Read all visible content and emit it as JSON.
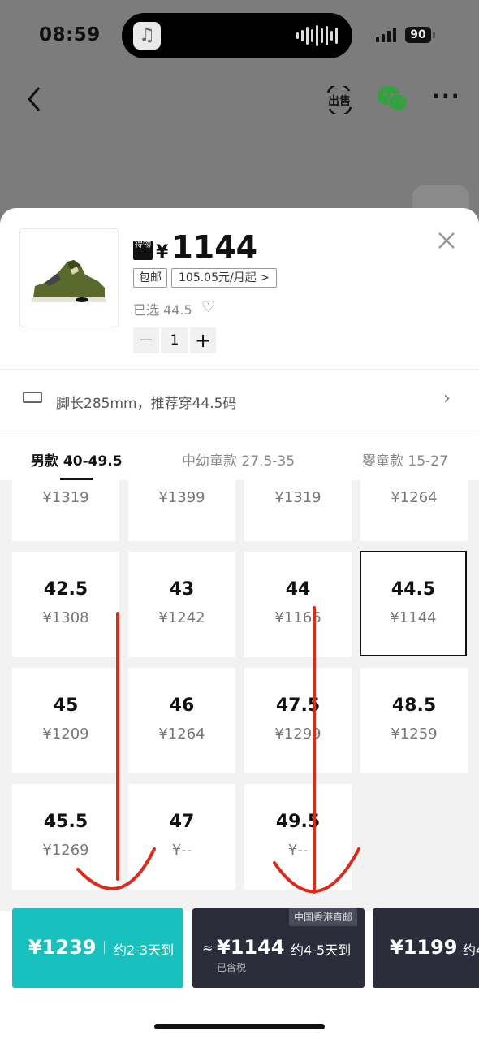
{
  "status_bar": {
    "time": "08:59",
    "battery": "90"
  },
  "nav": {
    "sell_label": "出售"
  },
  "product": {
    "logo_text": "得物",
    "currency": "¥",
    "price": "1144",
    "tag_shipping": "包邮",
    "tag_installment": "105.05元/月起",
    "selected_label": "已选 44.5",
    "quantity": "1"
  },
  "foot": {
    "text": "脚长285mm，推荐穿44.5码"
  },
  "tabs": [
    {
      "label": "男款 40-49.5"
    },
    {
      "label": "中幼童款 27.5-35"
    },
    {
      "label": "婴童款 15-27"
    }
  ],
  "grid": {
    "partial_row": [
      "¥1319",
      "¥1399",
      "¥1319",
      "¥1264"
    ],
    "cells": [
      {
        "size": "42.5",
        "price": "¥1308"
      },
      {
        "size": "43",
        "price": "¥1242"
      },
      {
        "size": "44",
        "price": "¥1166"
      },
      {
        "size": "44.5",
        "price": "¥1144"
      },
      {
        "size": "45",
        "price": "¥1209"
      },
      {
        "size": "46",
        "price": "¥1264"
      },
      {
        "size": "47.5",
        "price": "¥1299"
      },
      {
        "size": "48.5",
        "price": "¥1259"
      },
      {
        "size": "45.5",
        "price": "¥1269"
      },
      {
        "size": "47",
        "price": "¥--"
      },
      {
        "size": "49.5",
        "price": "¥--"
      }
    ]
  },
  "buttons": {
    "b1": {
      "price": "¥1239",
      "delivery": "约2-3天到"
    },
    "b2": {
      "approx": "≈",
      "price": "¥1144",
      "delivery": "约4-5天到",
      "tax": "已含税",
      "badge": "中国香港直邮"
    },
    "b3": {
      "price": "¥1199",
      "delivery": "约4"
    }
  },
  "colors": {
    "teal": "#18c1be",
    "dark": "#2c2d3a",
    "annotation_red": "#d92a1c"
  }
}
